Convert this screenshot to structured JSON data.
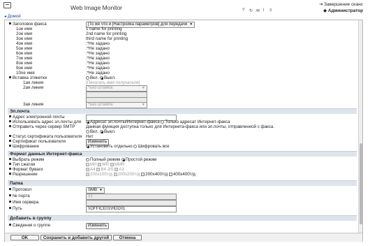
{
  "header": {
    "app_title": "Web Image Monitor",
    "logout_label": "Завершение сеанс",
    "user_label": "Администратор",
    "home_link": "Домой"
  },
  "fax": {
    "header_label": "Заголовок факса",
    "header_value": "[То же что и [Настройка параметров] для передачи",
    "names": [
      {
        "label": "1ое имя",
        "value": "1 name for printing"
      },
      {
        "label": "2ое имя",
        "value": "2nd name for printing"
      },
      {
        "label": "3ое имя",
        "value": "third name for printing"
      },
      {
        "label": "4ое имя",
        "value": ":*Не задано"
      },
      {
        "label": "5ое имя",
        "value": ":*Не задано"
      },
      {
        "label": "6ое имя",
        "value": ":*Не задано"
      },
      {
        "label": "7ое имя",
        "value": ":*Не задано"
      },
      {
        "label": "8ое имя",
        "value": ":*Не задано"
      },
      {
        "label": "9ое имя",
        "value": ":*Не задано"
      },
      {
        "label": "10ое имя",
        "value": ":*Не задано"
      }
    ],
    "label_insert": "Вставка этикетки",
    "label_on": "Вкл.",
    "label_off": "Выкл.",
    "line1_label": "1ая линия",
    "line1_value": "[Печатать имя получателя]",
    "line2_label": "2ая линия",
    "line2_value": "*Без штампа",
    "line3_label": "3ая линия",
    "line3_value": "*Без штампа"
  },
  "email": {
    "section_title": "Эл.почта",
    "address_label": "Адрес электронной почты",
    "address_value": "",
    "use_address_label": "Использовать адрес эл.почты для",
    "opt_fax_email": "Адресат эл.почты/Интернет-факса",
    "opt_ifax_only": "Только адресат Интернет-факса",
    "smtp_label": "Отправить через сервер SMTP",
    "smtp_note": "Данная функция доступна только для Интернета-факса или эл.почты, отправленной с факса.",
    "smtp_on": "Вкл.",
    "smtp_off": "Выкл.",
    "cert_status_label": "Статус сертификата пользователя",
    "cert_status_value": "Нет",
    "user_cert_label": "Сертификат пользователя",
    "change_button": "Изменить",
    "encryption_label": "Шифрование",
    "enc_individual": "Установить отдельно",
    "enc_all": "Шифровать все"
  },
  "ifax_format": {
    "section_title": "Формат данных Интернет-факса",
    "mode_label": "Выбрать режим",
    "mode_full": "Полный режим",
    "mode_simple": "Простой режим",
    "compression_label": "Тип сжатия",
    "comp_options": [
      "MH",
      "MR",
      "MMR"
    ],
    "paper_label": "Формат бумаги",
    "paper_options": [
      "A4",
      "B4 JIS",
      "A3"
    ],
    "resolution_label": "Разрешение",
    "res_options": [
      "200x100т/д",
      "200x200т/д",
      "200x400т/д",
      "400x400т/д"
    ]
  },
  "folder": {
    "section_title": "Папка",
    "protocol_label": "Протокол",
    "protocol_value": "SMB",
    "port_label": "№ порта",
    "port_value": "21",
    "server_label": "Имя сервера",
    "server_value": "",
    "path_label": "Путь",
    "path_value": "\\\\OFFICE01\\HDD01"
  },
  "group": {
    "section_title": "Добавить в группу",
    "info_label": "Сведения о группе",
    "change_button": "Изменить"
  },
  "footer": {
    "ok_label": "OK",
    "save_add_label": "Сохранить и добавить другой",
    "cancel_label": "Отмена"
  }
}
